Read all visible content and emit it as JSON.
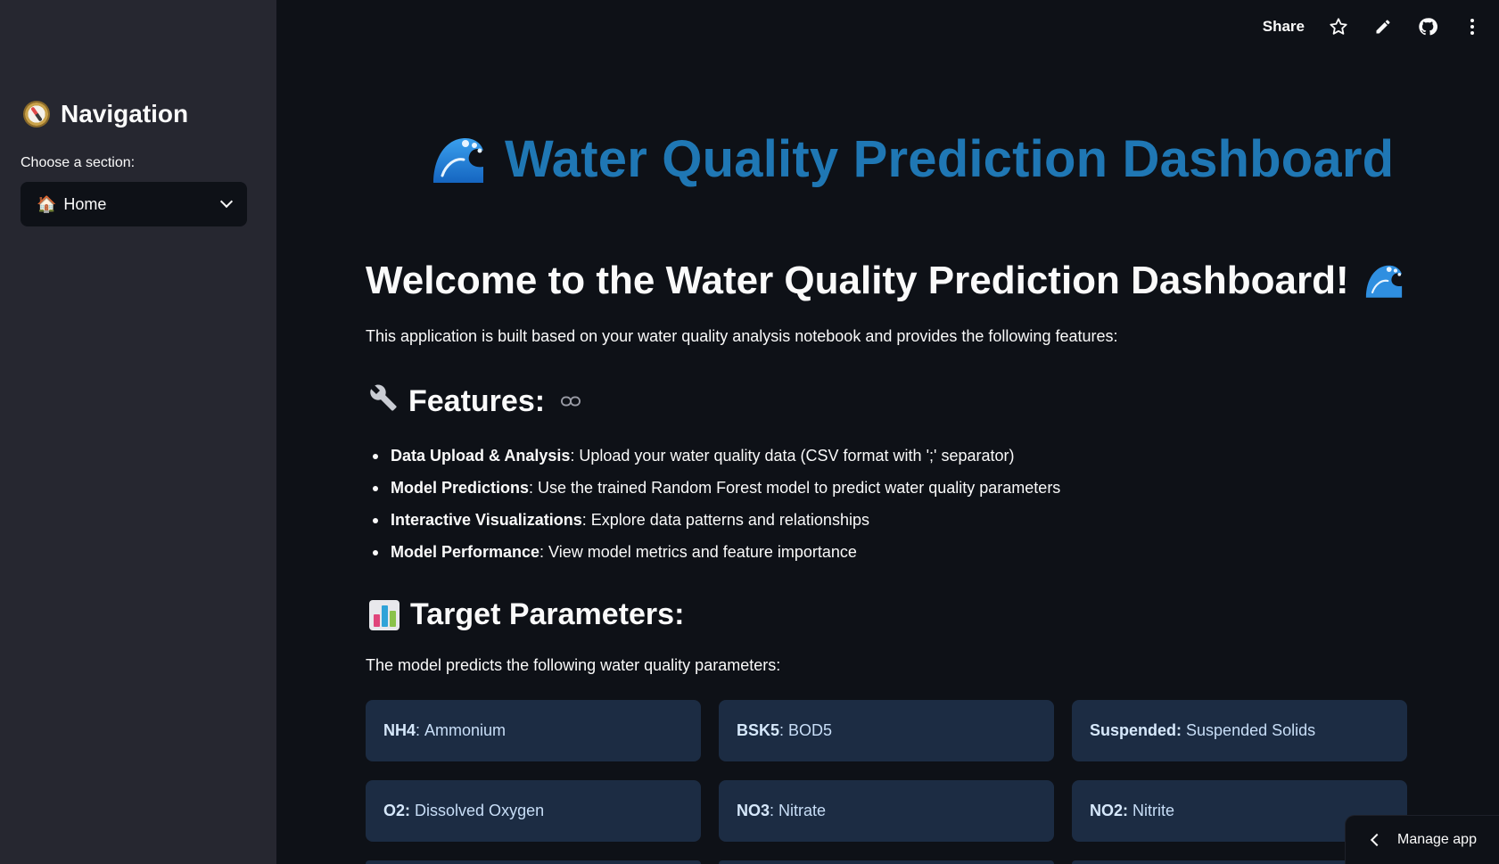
{
  "sidebar": {
    "title": "Navigation",
    "select_label": "Choose a section:",
    "selected_section": "Home",
    "selected_icon": "🏠"
  },
  "toolbar": {
    "share_label": "Share",
    "icons": [
      "star-icon",
      "pencil-icon",
      "github-icon",
      "more-vertical-icon"
    ]
  },
  "main": {
    "hero_title": "Water Quality Prediction Dashboard",
    "welcome_heading": "Welcome to the Water Quality Prediction Dashboard!",
    "intro": "This application is built based on your water quality analysis notebook and provides the following features:",
    "features_heading": "Features:",
    "features": [
      {
        "bold": "Data Upload & Analysis",
        "text": ": Upload your water quality data (CSV format with ';' separator)"
      },
      {
        "bold": "Model Predictions",
        "text": ": Use the trained Random Forest model to predict water quality parameters"
      },
      {
        "bold": "Interactive Visualizations",
        "text": ": Explore data patterns and relationships"
      },
      {
        "bold": "Model Performance",
        "text": ": View model metrics and feature importance"
      }
    ],
    "targets_heading": "Target Parameters:",
    "targets_intro": "The model predicts the following water quality parameters:",
    "targets": [
      {
        "code": "NH4",
        "sep": ": ",
        "name": "Ammonium"
      },
      {
        "code": "BSK5",
        "sep": ": ",
        "name": "BOD5"
      },
      {
        "code": "Suspended:",
        "sep": " ",
        "name": "Suspended Solids"
      },
      {
        "code": "O2:",
        "sep": " ",
        "name": "Dissolved Oxygen"
      },
      {
        "code": "NO3",
        "sep": ": ",
        "name": "Nitrate"
      },
      {
        "code": "NO2:",
        "sep": " ",
        "name": "Nitrite"
      }
    ]
  },
  "manage_app_label": "Manage app",
  "colors": {
    "background": "#0e1117",
    "sidebar": "#262730",
    "accent_title": "#1f77b4",
    "card": "#1c2c43"
  }
}
